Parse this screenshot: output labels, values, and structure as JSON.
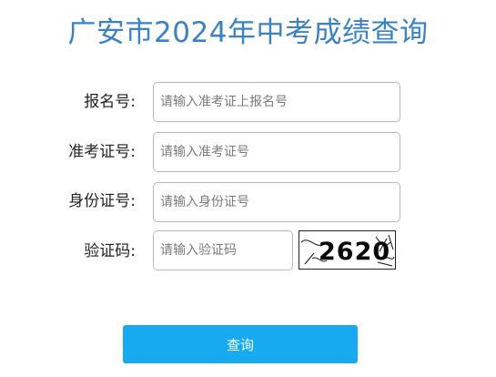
{
  "page": {
    "title": "广安市2024年中考成绩查询"
  },
  "form": {
    "fields": [
      {
        "label": "报名号:",
        "placeholder": "请输入准考证上报名号"
      },
      {
        "label": "准考证号:",
        "placeholder": "请输入准考证号"
      },
      {
        "label": "身份证号:",
        "placeholder": "请输入身份证号"
      },
      {
        "label": "验证码:",
        "placeholder": "请输入验证码"
      }
    ],
    "captcha": {
      "code": "2620"
    },
    "submit_label": "查询"
  }
}
